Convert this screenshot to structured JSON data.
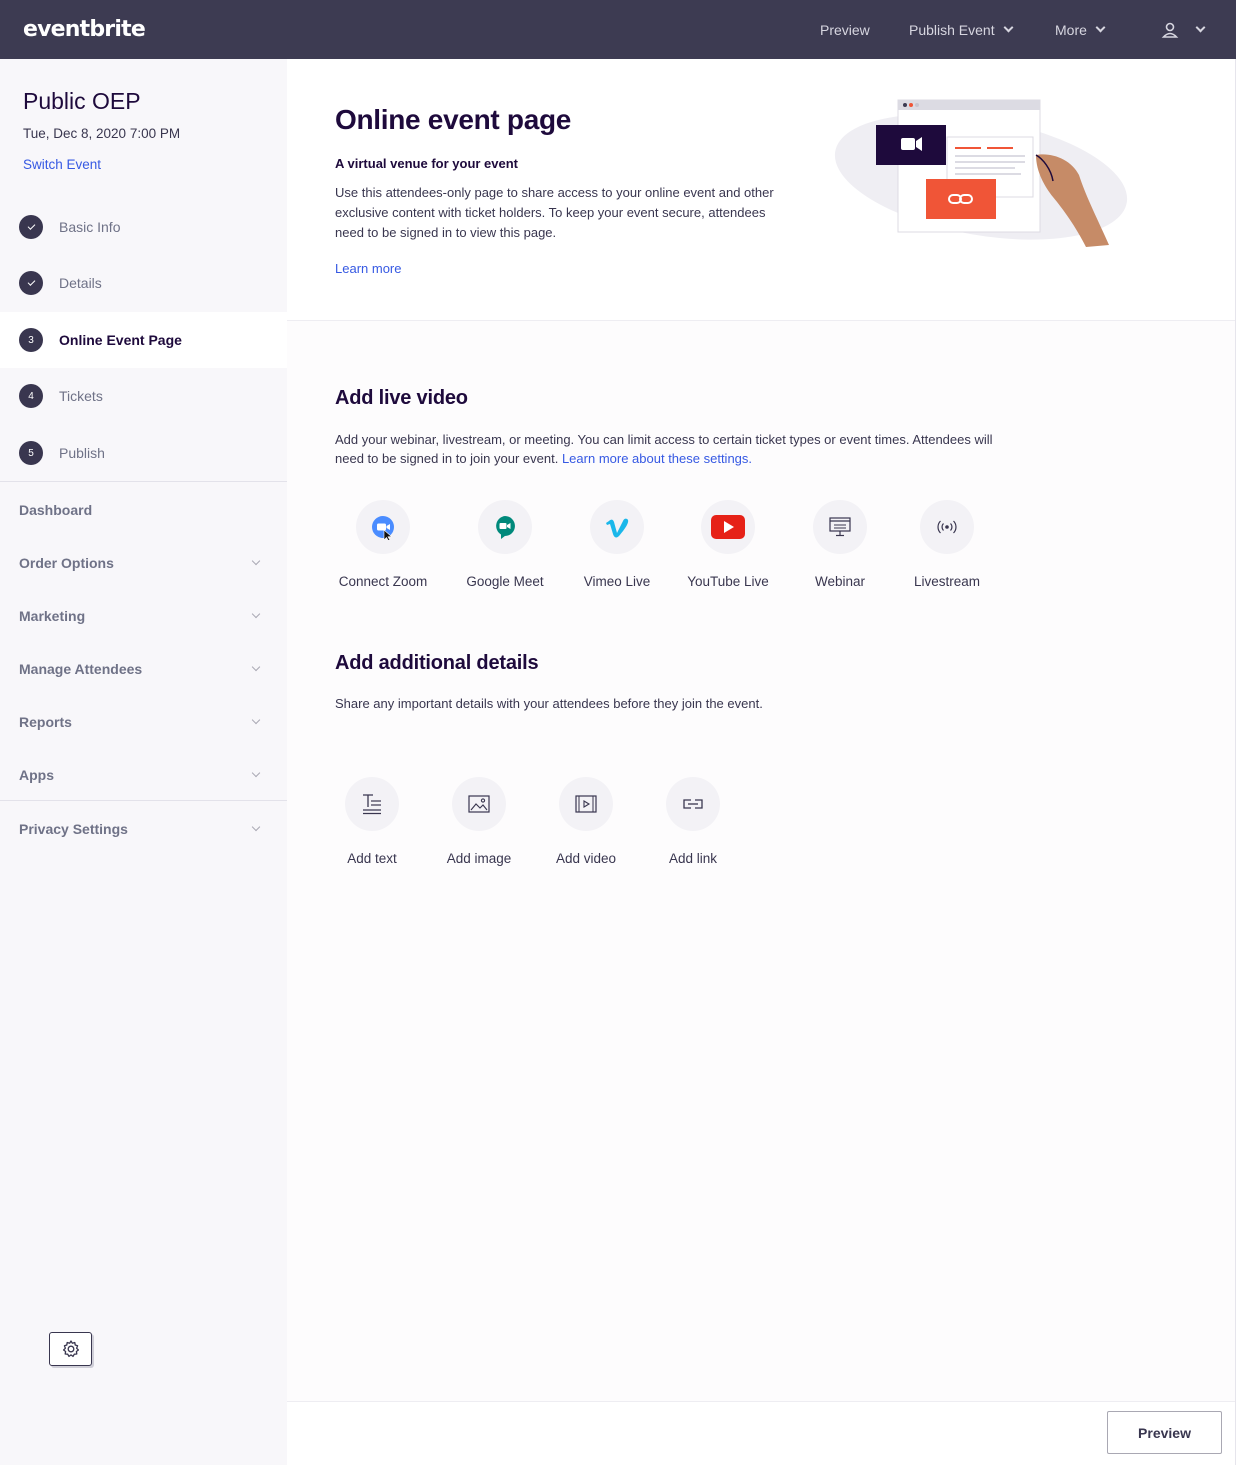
{
  "topbar": {
    "logo": "eventbrite",
    "preview": "Preview",
    "publish_event": "Publish Event",
    "more": "More"
  },
  "sidebar": {
    "event_title": "Public OEP",
    "event_date": "Tue, Dec 8, 2020 7:00 PM",
    "switch_event": "Switch Event",
    "steps": [
      {
        "num": "",
        "label": "Basic Info",
        "done": true
      },
      {
        "num": "",
        "label": "Details",
        "done": true
      },
      {
        "num": "3",
        "label": "Online Event Page",
        "active": true
      },
      {
        "num": "4",
        "label": "Tickets"
      },
      {
        "num": "5",
        "label": "Publish"
      }
    ],
    "items": [
      {
        "label": "Dashboard"
      },
      {
        "label": "Order Options"
      },
      {
        "label": "Marketing"
      },
      {
        "label": "Manage Attendees"
      },
      {
        "label": "Reports"
      },
      {
        "label": "Apps"
      },
      {
        "label": "Privacy Settings"
      }
    ]
  },
  "header": {
    "title": "Online event page",
    "subtitle": "A virtual venue for your event",
    "description": "Use this attendees-only page to share access to your online event and other exclusive content with ticket holders. To keep your event secure, attendees need to be signed in to view this page.",
    "learn_more": "Learn more"
  },
  "live_video": {
    "title": "Add live video",
    "description": "Add your webinar, livestream, or meeting. You can limit access to certain ticket types or event times. Attendees will need to be signed in to join your event.",
    "link": "Learn more about these settings.",
    "options": [
      {
        "label": "Connect Zoom",
        "icon": "zoom-icon"
      },
      {
        "label": "Google Meet",
        "icon": "google-meet-icon"
      },
      {
        "label": "Vimeo Live",
        "icon": "vimeo-icon"
      },
      {
        "label": "YouTube Live",
        "icon": "youtube-icon"
      },
      {
        "label": "Webinar",
        "icon": "webinar-icon"
      },
      {
        "label": "Livestream",
        "icon": "livestream-icon"
      }
    ]
  },
  "additional": {
    "title": "Add additional details",
    "description": "Share any important details with your attendees before they join the event.",
    "options": [
      {
        "label": "Add text",
        "icon": "text-icon"
      },
      {
        "label": "Add image",
        "icon": "image-icon"
      },
      {
        "label": "Add video",
        "icon": "video-icon"
      },
      {
        "label": "Add link",
        "icon": "link-icon"
      }
    ]
  },
  "footer": {
    "preview": "Preview"
  },
  "colors": {
    "topbar": "#3d3b52",
    "link": "#3659e3",
    "heading": "#1e0a3c",
    "accent_orange": "#f05537"
  }
}
